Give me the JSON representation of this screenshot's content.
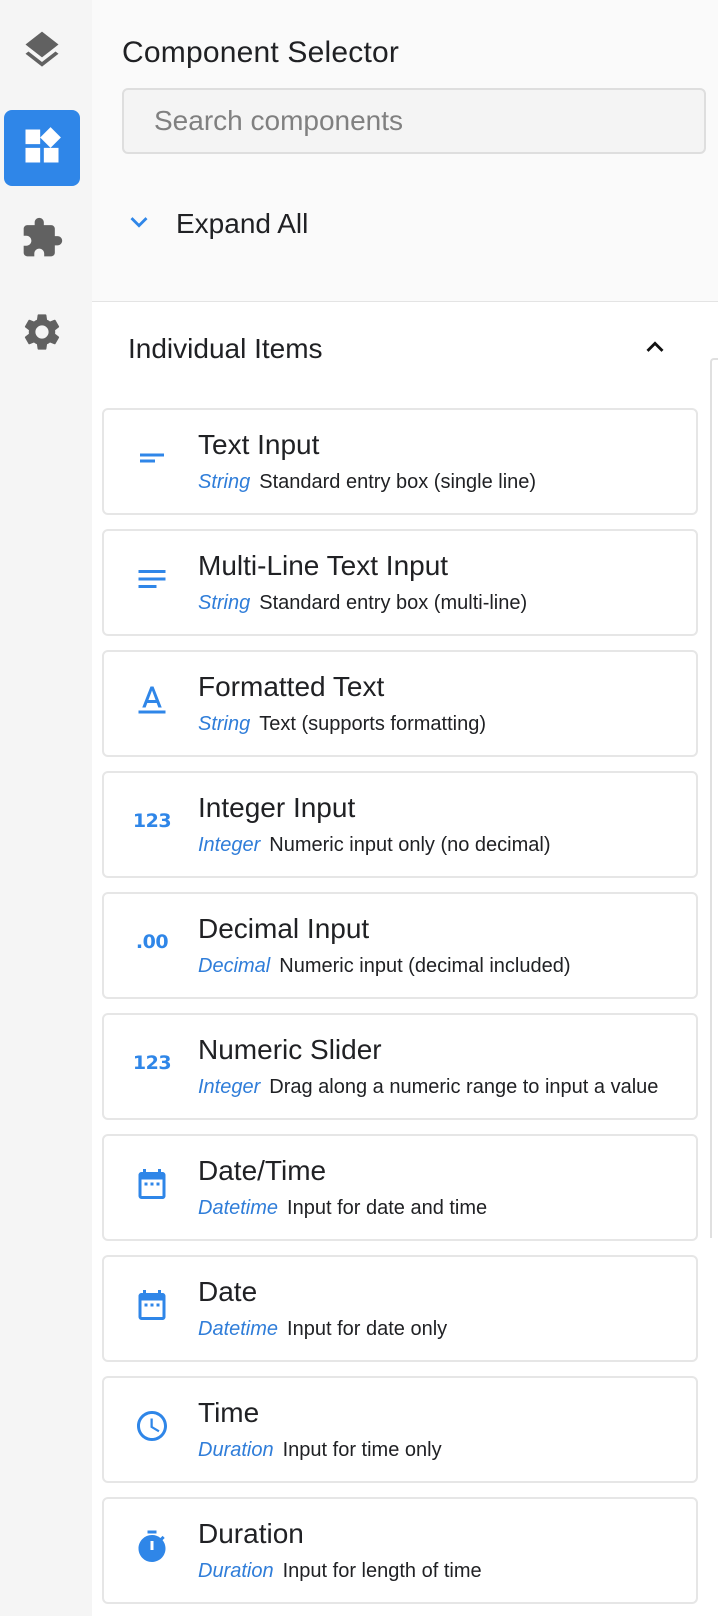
{
  "rail": {
    "items": [
      {
        "name": "layers",
        "icon": "layers-icon",
        "active": false
      },
      {
        "name": "components",
        "icon": "widgets-icon",
        "active": true
      },
      {
        "name": "extensions",
        "icon": "puzzle-icon",
        "active": false
      },
      {
        "name": "settings",
        "icon": "gear-icon",
        "active": false
      }
    ]
  },
  "header": {
    "title": "Component Selector",
    "search_placeholder": "Search components",
    "expand_label": "Expand All"
  },
  "section": {
    "title": "Individual Items",
    "items": [
      {
        "name": "Text Input",
        "type": "String",
        "desc": "Standard entry box (single line)",
        "icon": "short-text-icon"
      },
      {
        "name": "Multi-Line Text Input",
        "type": "String",
        "desc": "Standard entry box (multi-line)",
        "icon": "notes-icon"
      },
      {
        "name": "Formatted Text",
        "type": "String",
        "desc": "Text (supports formatting)",
        "icon": "format-color-text-icon"
      },
      {
        "name": "Integer Input",
        "type": "Integer",
        "desc": "Numeric input only (no decimal)",
        "icon": "numbers-123-icon",
        "glyph": "123"
      },
      {
        "name": "Decimal Input",
        "type": "Decimal",
        "desc": "Numeric input (decimal included)",
        "icon": "decimal-icon",
        "glyph": ".00"
      },
      {
        "name": "Numeric Slider",
        "type": "Integer",
        "desc": "Drag along a numeric range to input a value",
        "icon": "numbers-123-icon",
        "glyph": "123"
      },
      {
        "name": "Date/Time",
        "type": "Datetime",
        "desc": "Input for date and time",
        "icon": "calendar-icon"
      },
      {
        "name": "Date",
        "type": "Datetime",
        "desc": "Input for date only",
        "icon": "calendar-icon"
      },
      {
        "name": "Time",
        "type": "Duration",
        "desc": "Input for time only",
        "icon": "clock-icon"
      },
      {
        "name": "Duration",
        "type": "Duration",
        "desc": "Input for length of time",
        "icon": "stopwatch-icon"
      }
    ]
  },
  "colors": {
    "accent": "#2f86e8",
    "type_text": "#2f7dd9",
    "rail_bg": "#f5f5f5"
  }
}
